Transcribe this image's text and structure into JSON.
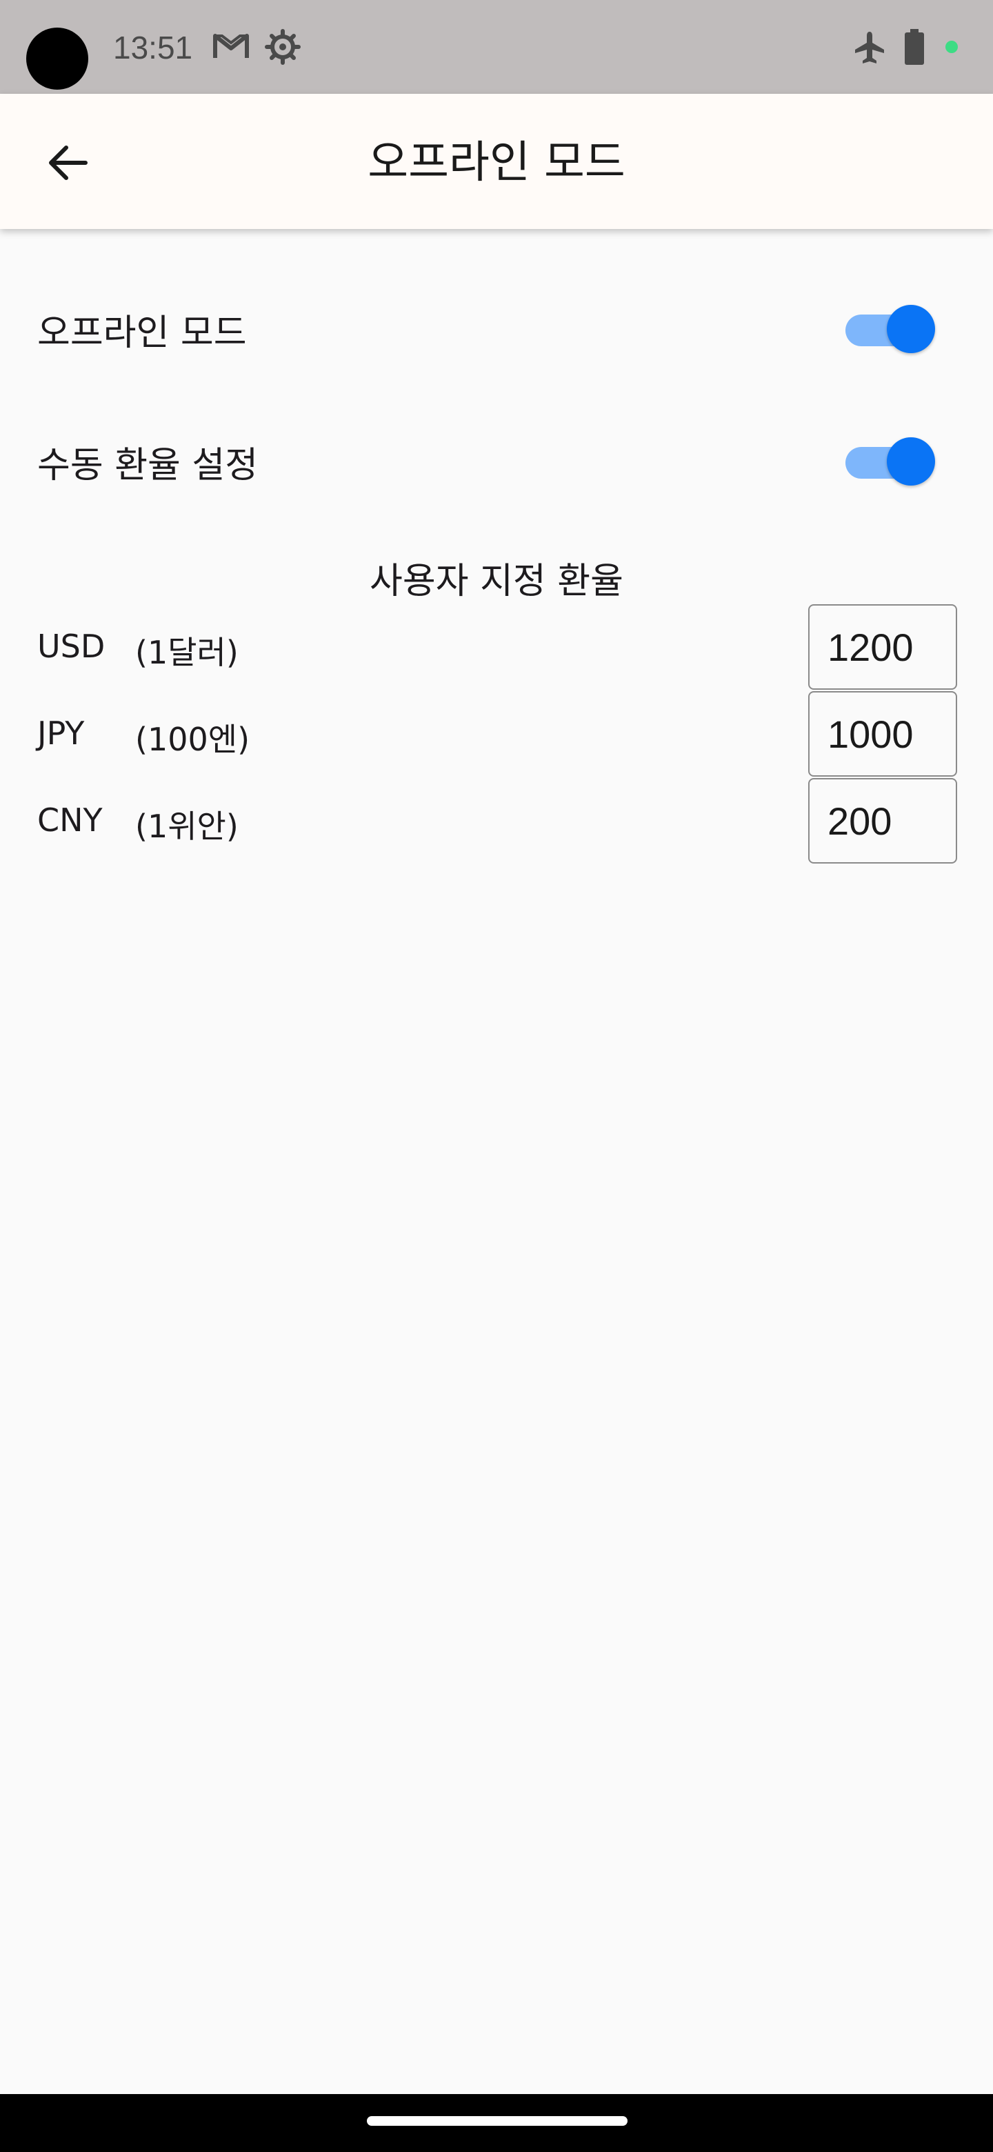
{
  "status_bar": {
    "time": "13:51",
    "left_icons": [
      "gmail-icon",
      "settings-gear-icon"
    ],
    "right_icons": [
      "airplane-icon",
      "battery-icon",
      "green-dot-indicator"
    ],
    "indicator_color": "#3ddc84"
  },
  "app_bar": {
    "title": "오프라인 모드",
    "back_icon": "arrow-left-icon"
  },
  "settings": {
    "offline_mode": {
      "label": "오프라인 모드",
      "enabled": true
    },
    "manual_rate": {
      "label": "수동 환율 설정",
      "enabled": true
    }
  },
  "custom_rates": {
    "title": "사용자 지정 환율",
    "rows": [
      {
        "code": "USD",
        "unit": "(1달러)",
        "value": "1200"
      },
      {
        "code": "JPY",
        "unit": "(100엔)",
        "value": "1000"
      },
      {
        "code": "CNY",
        "unit": "(1위안)",
        "value": "200"
      }
    ]
  },
  "colors": {
    "accent": "#0a74f5",
    "toggle_track": "#7eb6fb",
    "status_bar_bg": "#c0bcbc",
    "app_bar_bg": "#fffbf8",
    "page_bg": "#fafafa"
  }
}
